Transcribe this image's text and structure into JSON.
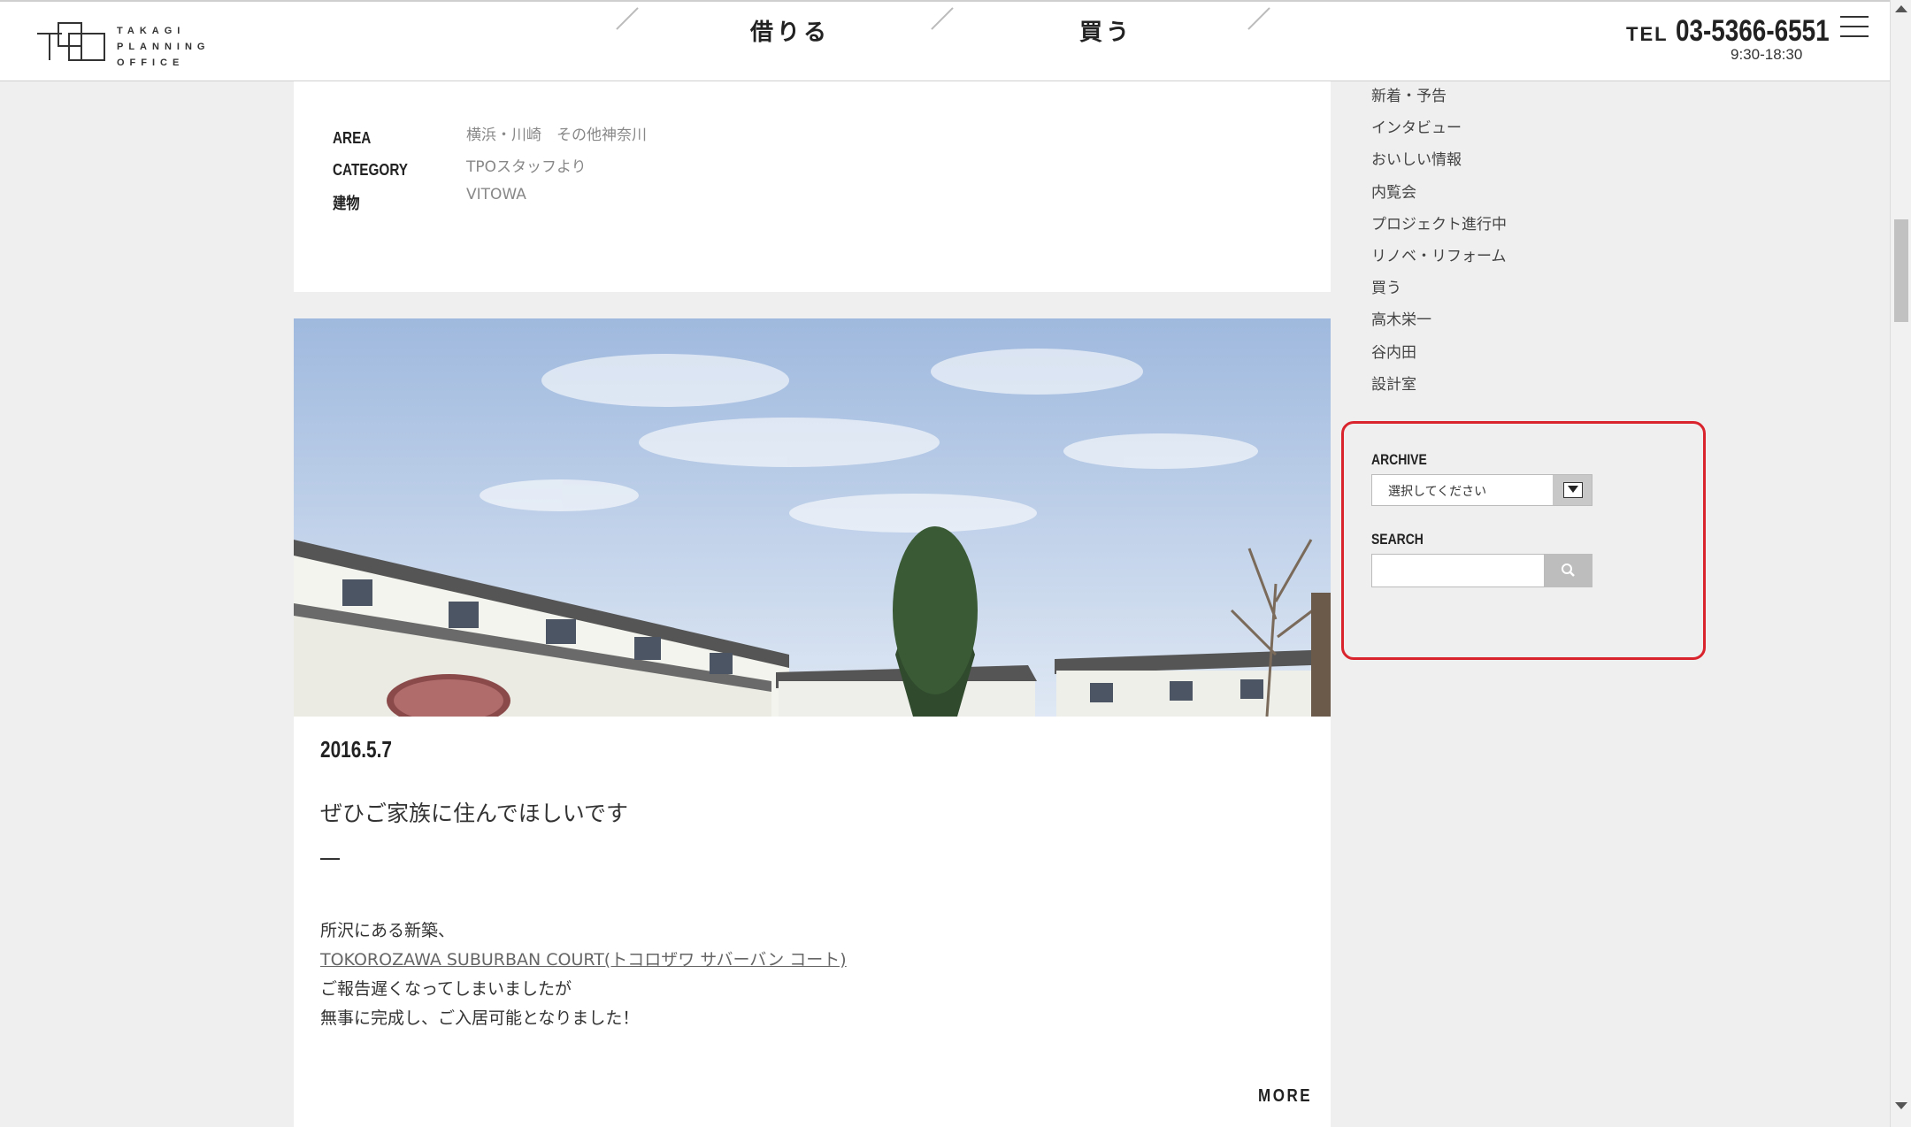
{
  "header": {
    "logo_text": [
      "TAKAGI",
      "PLANNING",
      "OFFICE"
    ],
    "nav": [
      {
        "label": "借りる"
      },
      {
        "label": "買う"
      }
    ],
    "tel_label": "TEL",
    "tel_number": "03-5366-6551",
    "tel_hours": "9:30-18:30",
    "menu_icon": "hamburger-icon"
  },
  "prev_post_meta": [
    {
      "label": "AREA",
      "value": "横浜・川崎　その他神奈川"
    },
    {
      "label": "CATEGORY",
      "value": "TPOスタッフより"
    },
    {
      "label": "建物",
      "value": "VITOWA"
    }
  ],
  "post": {
    "image_alt": "Photo of white residential buildings and a tree under a blue sky with a SUBURBAN COURT sign",
    "date": "2016.5.7",
    "title": "ぜひご家族に住んでほしいです",
    "body_line1": "所沢にある新築、",
    "body_link": "TOKOROZAWA SUBURBAN COURT(トコロザワ サバーバン コート)",
    "body_line3": "ご報告遅くなってしまいましたが",
    "body_line4": "無事に完成し、ご入居可能となりました！",
    "more_label": "MORE"
  },
  "sidebar": {
    "categories": [
      "新着・予告",
      "インタビュー",
      "おいしい情報",
      "内覧会",
      "プロジェクト進行中",
      "リノベ・リフォーム",
      "買う",
      "高木栄一",
      "谷内田",
      "設計室"
    ],
    "archive_label": "ARCHIVE",
    "archive_selected": "選択してください",
    "search_label": "SEARCH",
    "search_value": "",
    "highlight_color": "#d9232d"
  }
}
